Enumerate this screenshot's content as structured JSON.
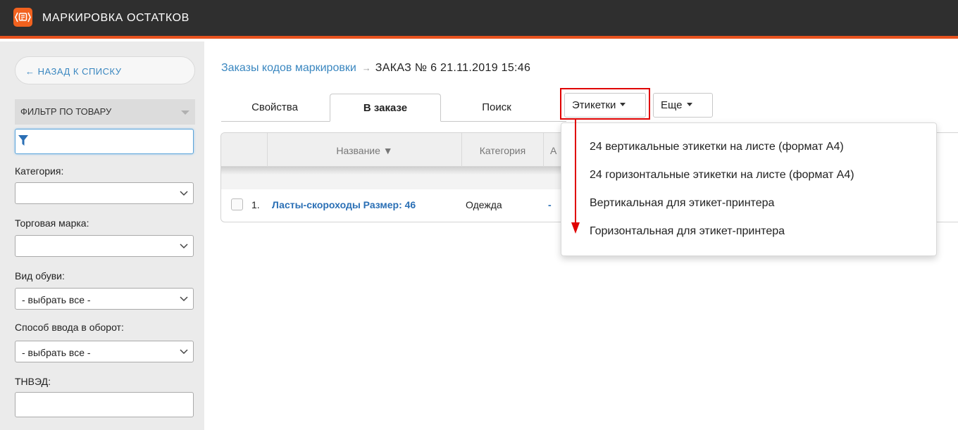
{
  "app": {
    "title": "МАРКИРОВКА ОСТАТКОВ",
    "accent": "#f2621f",
    "topbar_color": "#2f2f2f"
  },
  "sidebar": {
    "back_label": "← НАЗАД К СПИСКУ",
    "filter_header": "ФИЛЬТР ПО ТОВАРУ",
    "filter_placeholder": "",
    "category_label": "Категория:",
    "category_value": "",
    "brand_label": "Торговая марка:",
    "brand_value": "",
    "shoe_type_label": "Вид обуви:",
    "shoe_type_value": "- выбрать все -",
    "circulation_label": "Способ ввода в оборот:",
    "circulation_value": "- выбрать все -",
    "tnved_label": "ТНВЭД:",
    "tnved_value": ""
  },
  "breadcrumb": {
    "link": "Заказы кодов маркировки",
    "separator": "→",
    "current": "ЗАКАЗ № 6 21.11.2019 15:46"
  },
  "tabs": [
    {
      "label": "Свойства",
      "active": false
    },
    {
      "label": "В заказе",
      "active": true
    },
    {
      "label": "Поиск",
      "active": false
    }
  ],
  "buttons": {
    "labels": "Этикетки",
    "more": "Еще"
  },
  "grid": {
    "columns": [
      "Название ▼",
      "Категория",
      "А"
    ],
    "rows": [
      {
        "num": "1.",
        "name": "Ласты-скороходы Размер: 46",
        "category": "Одежда",
        "extra": "-"
      }
    ]
  },
  "labels_menu": {
    "items": [
      "24 вертикальные этикетки на листе (формат А4)",
      "24 горизонтальные этикетки на листе (формат А4)",
      "Вертикальная для этикет-принтера",
      "Горизонтальная для этикет-принтера"
    ]
  },
  "annotation": {
    "highlight_color": "#e00000"
  }
}
